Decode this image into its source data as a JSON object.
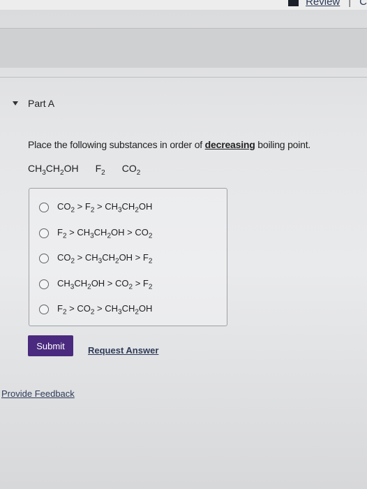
{
  "top_nav": {
    "review_label": "Review",
    "separator": "|",
    "cutoff_label": "C"
  },
  "part": {
    "label": "Part A"
  },
  "question": {
    "prefix": "Place the following substances in order of ",
    "emphasis": "decreasing",
    "suffix": " boiling point."
  },
  "substances": [
    {
      "parts": [
        "CH",
        "3",
        "CH",
        "2",
        "OH"
      ]
    },
    {
      "parts": [
        "F",
        "2"
      ]
    },
    {
      "parts": [
        "CO",
        "2"
      ]
    }
  ],
  "choices": [
    {
      "label": [
        "CO",
        "2",
        " > F",
        "2",
        " > CH",
        "3",
        "CH",
        "2",
        "OH"
      ]
    },
    {
      "label": [
        "F",
        "2",
        " > CH",
        "3",
        "CH",
        "2",
        "OH > CO",
        "2",
        ""
      ]
    },
    {
      "label": [
        "CO",
        "2",
        " > CH",
        "3",
        "CH",
        "2",
        "OH > F",
        "2",
        ""
      ]
    },
    {
      "label": [
        "CH",
        "3",
        "CH",
        "2",
        "OH > CO",
        "2",
        " > F",
        "2",
        ""
      ]
    },
    {
      "label": [
        "F",
        "2",
        " > CO",
        "2",
        " > CH",
        "3",
        "CH",
        "2",
        "OH"
      ]
    }
  ],
  "actions": {
    "submit_label": "Submit",
    "request_answer_label": "Request Answer"
  },
  "footer": {
    "feedback_label": "Provide Feedback"
  },
  "colors": {
    "submit_bg": "#4a2a7e",
    "link": "#2e3b58"
  }
}
